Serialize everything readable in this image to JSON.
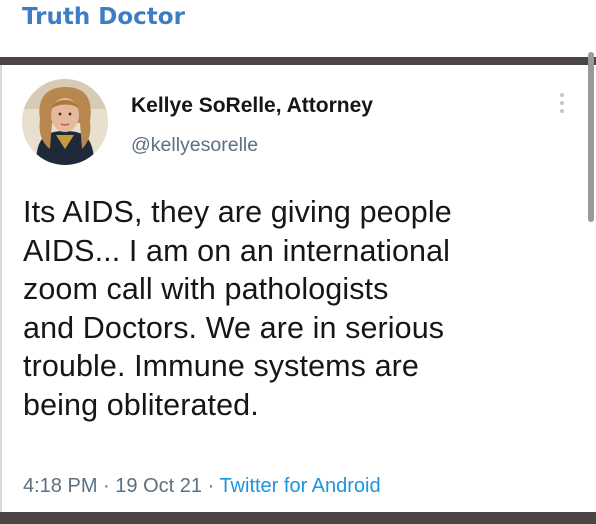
{
  "channel": {
    "title": "Truth Doctor"
  },
  "tweet": {
    "author": {
      "name": "Kellye SoRelle, Attorney",
      "handle": "@kellyesorelle",
      "avatar_icon": "profile-photo"
    },
    "more_icon": "vertical-ellipsis-icon",
    "text_lines": [
      "Its AIDS, they are giving people",
      "AIDS... I am on an international",
      "zoom call with pathologists",
      "and Doctors. We are in serious",
      "trouble. Immune systems are",
      "being obliterated."
    ],
    "meta": {
      "time": "4:18 PM",
      "separator": "·",
      "date": "19 Oct 21",
      "source": "Twitter for Android"
    }
  },
  "colors": {
    "channel_title": "#3d7ec2",
    "rule": "#4a4444",
    "link": "#1b95e0",
    "muted": "#5b7083",
    "text": "#14171a"
  }
}
